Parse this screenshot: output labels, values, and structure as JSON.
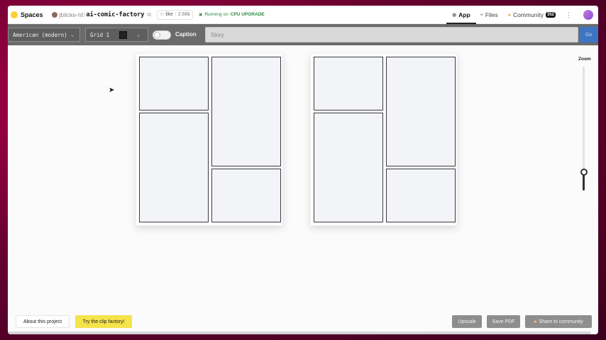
{
  "header": {
    "spaces_label": "Spaces",
    "owner": "jbilcke-hf",
    "separator": "/",
    "repo_name": "ai-comic-factory",
    "like_label": "like",
    "like_count": "2.66k",
    "status_prefix": "Running on",
    "status_hardware": "CPU UPGRADE",
    "nav": {
      "app": "App",
      "files": "Files",
      "community": "Community",
      "community_badge": "352"
    }
  },
  "toolbar": {
    "style_value": "American (modern)",
    "layout_value": "Grid 1",
    "caption_label": "Caption",
    "caption_on": false,
    "story_placeholder": "Story",
    "go_label": "Go"
  },
  "canvas": {
    "zoom_label": "Zoom",
    "zoom_level": 0.15,
    "pages": [
      {
        "panels": 4
      },
      {
        "panels": 4
      }
    ]
  },
  "footer": {
    "about_label": "About this project",
    "clip_label": "Try the clip factory!",
    "upscale_label": "Upscale",
    "save_pdf_label": "Save PDF",
    "share_label": "Share to community"
  },
  "icons": {
    "spaces": "hf-emoji-icon",
    "copy": "copy-icon",
    "like": "heart-icon",
    "running": "running-icon",
    "app": "app-icon",
    "files": "files-icon",
    "community": "community-icon",
    "more": "kebab-icon",
    "share": "share-icon",
    "cursor": "cursor-icon"
  },
  "colors": {
    "toolbar_bg": "#6b6b6b",
    "go_button": "#3f74c4",
    "clip_button": "#f5e34a",
    "action_button": "#8e8e8e",
    "running_text": "#2b8a3e"
  }
}
